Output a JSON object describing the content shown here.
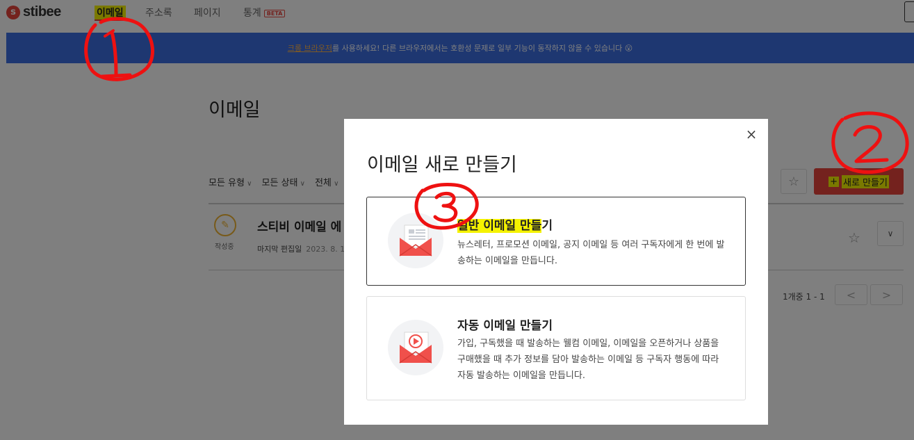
{
  "nav": {
    "logo_mark": "s",
    "logo_text": "stibee",
    "items": [
      {
        "label": "이메일"
      },
      {
        "label": "주소록"
      },
      {
        "label": "페이지"
      },
      {
        "label": "통계"
      }
    ],
    "beta": "BETA"
  },
  "banner": {
    "link": "크롬 브라우저",
    "text": "를 사용하세요! 다른 브라우저에서는 호환성 문제로 일부 기능이 동작하지 않을 수 있습니다 😮"
  },
  "page": {
    "title": "이메일",
    "filters": [
      "모든 유형",
      "모든 상태",
      "전체"
    ],
    "favorite_icon": "star-icon",
    "new_button": {
      "plus": "+",
      "label": "새로 만들기"
    }
  },
  "list": {
    "rows": [
      {
        "status": "작성중",
        "title": "스티비 이메일 에",
        "meta_label": "마지막 편집일",
        "meta_date": "2023. 8. 1"
      }
    ]
  },
  "pagination": {
    "summary": "1개중 1 - 1",
    "prev": "<",
    "next": ">"
  },
  "modal": {
    "title": "이메일 새로 만들기",
    "close": "×",
    "options": [
      {
        "title_highlight": "일반 이메일 만들",
        "title_rest": "기",
        "description": "뉴스레터, 프로모션 이메일, 공지 이메일 등 여러 구독자에게 한 번에 발송하는 이메일을 만듭니다."
      },
      {
        "title_highlight": "",
        "title_rest": "자동 이메일 만들기",
        "description": "가입, 구독했을 때 발송하는 웰컴 이메일, 이메일을 오픈하거나 상품을 구매했을 때 추가 정보를 담아 발송하는 이메일 등 구독자 행동에 따라 자동 발송하는 이메일을 만듭니다."
      }
    ]
  },
  "colors": {
    "brand": "#e8453c",
    "banner": "#3d6ee3",
    "highlight": "#f5f200",
    "annotation": "#ee1111"
  }
}
